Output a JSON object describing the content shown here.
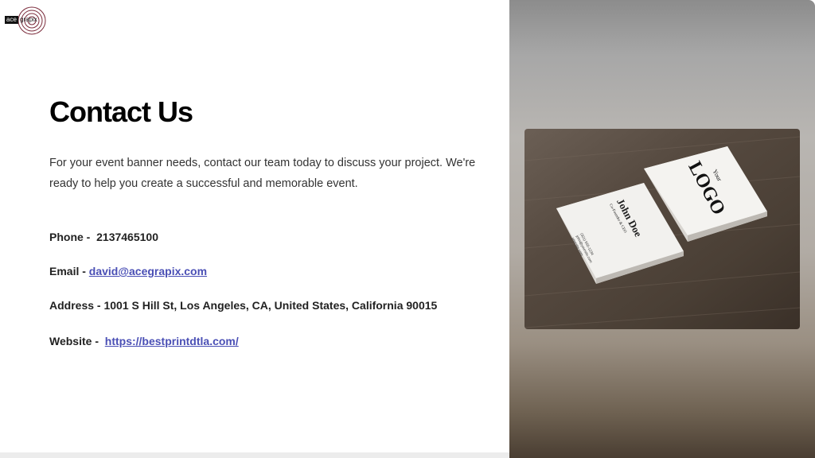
{
  "logo": {
    "mark_text": "ace",
    "wordmark_text": "grapix"
  },
  "heading": "Contact Us",
  "intro": "For your event banner needs, contact our team today to discuss your project. We're ready to help you create a successful and memorable event.",
  "contacts": {
    "phone_label": "Phone -",
    "phone_value": "2137465100",
    "email_label": "Email -",
    "email_value": "david@acegrapix.com",
    "address_label": "Address -",
    "address_value": "1001 S Hill St, Los Angeles, CA, United States, California 90015",
    "website_label": "Website -",
    "website_value": "https://bestprintdtla.com/"
  },
  "photo": {
    "card_back_small": "Your",
    "card_back_big": "LOGO",
    "card_front_name": "John Doe",
    "card_front_title": "Co-Founder & CEO",
    "card_front_lines": [
      "(321) 555-1234",
      "john@yoursite.com",
      "yoursite.com"
    ]
  },
  "colors": {
    "link": "#4a4fb5",
    "heading": "#000000",
    "body_text": "#333333"
  }
}
